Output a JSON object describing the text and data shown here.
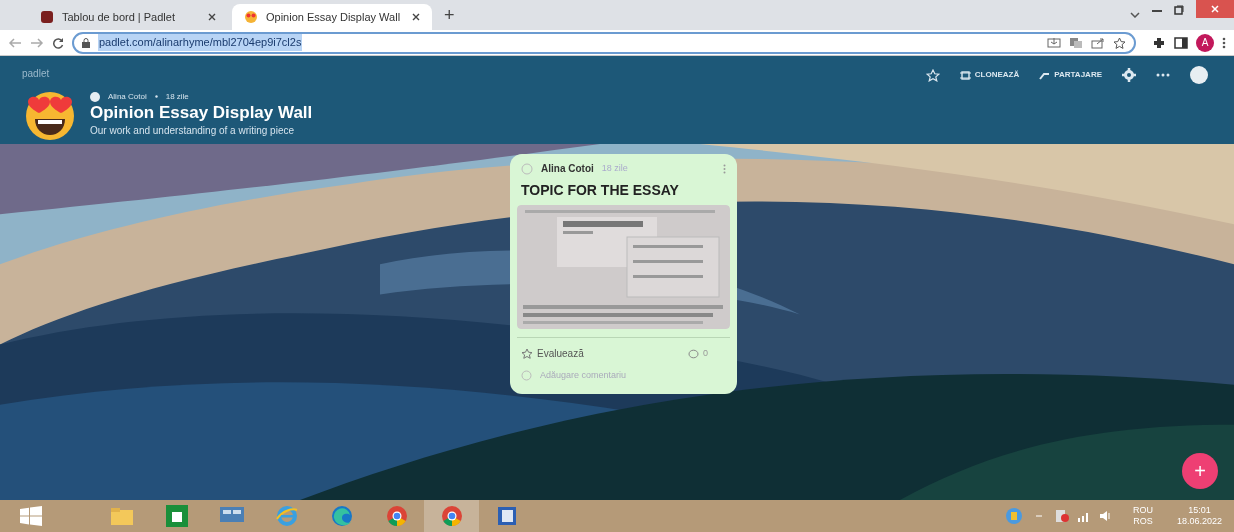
{
  "browser": {
    "tabs": [
      {
        "title": "Tablou de bord | Padlet",
        "selected": false
      },
      {
        "title": "Opinion Essay Display Wall",
        "selected": true
      }
    ],
    "new_tab": "+",
    "url": "padlet.com/alinarhyme/mbl2704ep9i7cl2s",
    "profile": "A"
  },
  "header": {
    "brand": "padlet",
    "author": "Alina Cotoi",
    "age": "18 zile",
    "title": "Opinion Essay Display Wall",
    "subtitle": "Our work and understanding of a writing piece",
    "actions": [
      {
        "kind": "star"
      },
      {
        "kind": "clone",
        "label": "CLONEAZĂ"
      },
      {
        "kind": "share",
        "label": "PARTAJARE"
      },
      {
        "kind": "settings"
      },
      {
        "kind": "more"
      },
      {
        "kind": "avatar"
      }
    ]
  },
  "post": {
    "author": "Alina Cotoi",
    "age": "18 zile",
    "title": "TOPIC FOR THE ESSAY",
    "rate": "Evaluează",
    "comments": "0",
    "comment_placeholder": "Adăugare comentariu"
  },
  "fab": "+",
  "taskbar": {
    "apps": [
      {
        "kind": "explorer"
      },
      {
        "kind": "store"
      },
      {
        "kind": "display"
      },
      {
        "kind": "ie"
      },
      {
        "kind": "edge"
      },
      {
        "kind": "chrome",
        "selected": false
      },
      {
        "kind": "chrome",
        "selected": true
      },
      {
        "kind": "word",
        "selected": false
      }
    ],
    "lang": "ROU",
    "lang2": "ROS",
    "time": "15:01",
    "date": "18.06.2022"
  }
}
